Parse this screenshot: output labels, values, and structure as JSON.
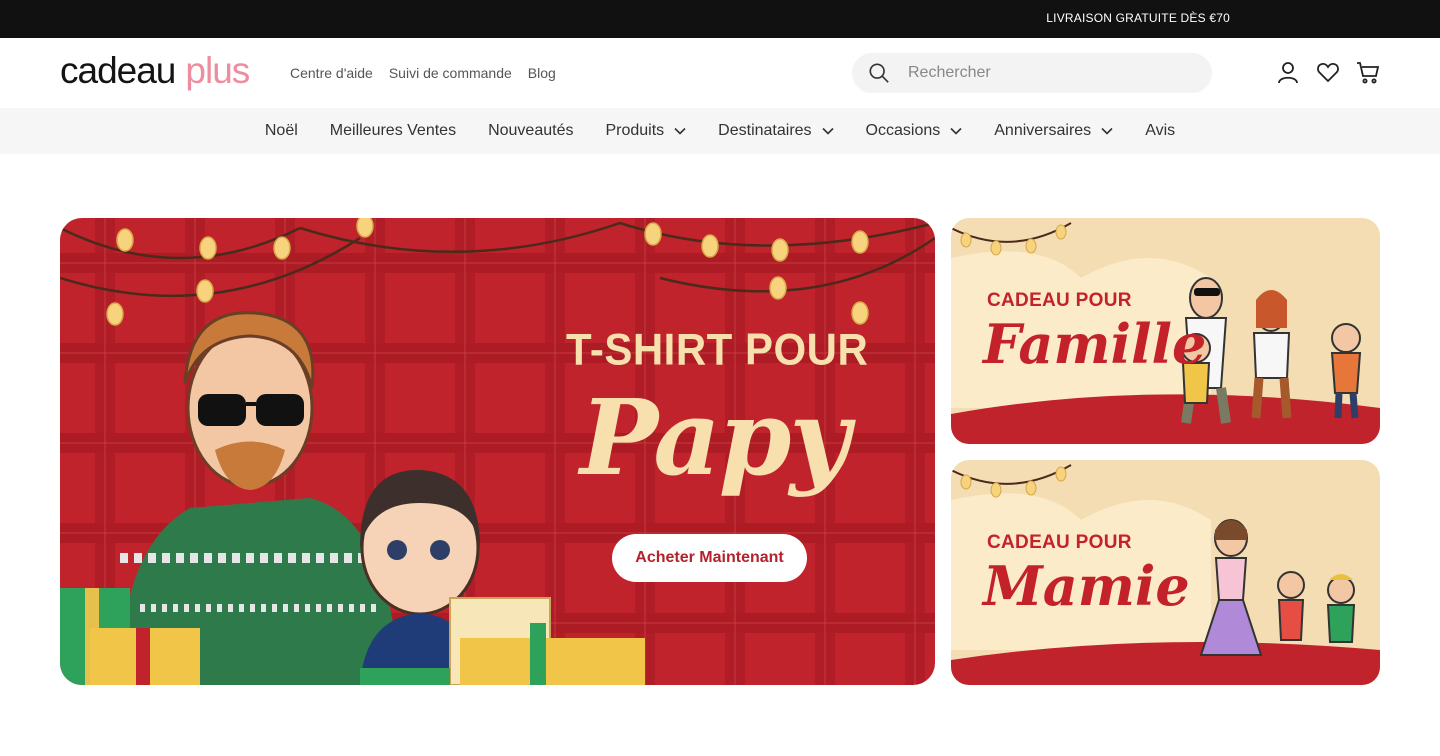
{
  "announcement": "LIVRAISON GRATUITE DÈS €70",
  "logo": {
    "part1": "cadeau",
    "part2": "plus"
  },
  "top_links": [
    "Centre d'aide",
    "Suivi de commande",
    "Blog"
  ],
  "search": {
    "placeholder": "Rechercher"
  },
  "header_icons": [
    "account-icon",
    "heart-icon",
    "cart-icon"
  ],
  "nav": [
    {
      "label": "Noël",
      "dropdown": false
    },
    {
      "label": "Meilleures Ventes",
      "dropdown": false
    },
    {
      "label": "Nouveautés",
      "dropdown": false
    },
    {
      "label": "Produits",
      "dropdown": true
    },
    {
      "label": "Destinataires",
      "dropdown": true
    },
    {
      "label": "Occasions",
      "dropdown": true
    },
    {
      "label": "Anniversaires",
      "dropdown": true
    },
    {
      "label": "Avis",
      "dropdown": false
    }
  ],
  "hero": {
    "title_line1": "T-SHIRT POUR",
    "title_line2": "Papy",
    "cta": "Acheter Maintenant"
  },
  "side_banners": [
    {
      "line1": "CADEAU POUR",
      "line2": "Famille"
    },
    {
      "line1": "CADEAU POUR",
      "line2": "Mamie"
    }
  ],
  "colors": {
    "announce_bg": "#111111",
    "logo_accent": "#ef8da0",
    "hero_red": "#c0232c",
    "banner_cream": "#f9e7c3",
    "title_cream": "#f7dfae"
  }
}
